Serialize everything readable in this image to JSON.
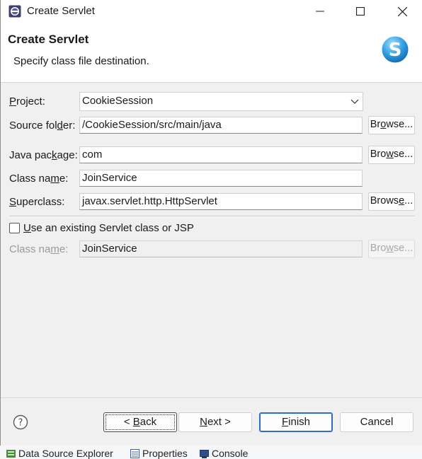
{
  "window": {
    "title": "Create Servlet",
    "app_icon": "eclipse-icon",
    "controls": [
      "minimize-icon",
      "maximize-icon",
      "close-icon"
    ]
  },
  "banner": {
    "title": "Create Servlet",
    "subtitle": "Specify class file destination.",
    "logo_letter": "S"
  },
  "form": {
    "project": {
      "label_pre": "",
      "label_u": "P",
      "label_post": "roject:",
      "value": "CookieSession"
    },
    "source_folder": {
      "label_pre": "Source fol",
      "label_u": "d",
      "label_post": "er:",
      "value": "/CookieSession/src/main/java",
      "browse": {
        "pre": "Br",
        "u": "o",
        "post": "wse..."
      }
    },
    "java_package": {
      "label_pre": "Java pac",
      "label_u": "k",
      "label_post": "age:",
      "value": "com",
      "browse": {
        "pre": "Bro",
        "u": "w",
        "post": "se..."
      }
    },
    "class_name": {
      "label_pre": "Class na",
      "label_u": "m",
      "label_post": "e:",
      "value": "JoinService"
    },
    "superclass": {
      "label_pre": "",
      "label_u": "S",
      "label_post": "uperclass:",
      "value": "javax.servlet.http.HttpServlet",
      "browse": {
        "pre": "Brows",
        "u": "e",
        "post": "..."
      }
    },
    "existing": {
      "label_pre": "",
      "label_u": "U",
      "label_post": "se an existing Servlet class or JSP",
      "checked": false
    },
    "existing_class_name": {
      "label_pre": "Class na",
      "label_u": "m",
      "label_post": "e:",
      "value": "JoinService",
      "browse": {
        "pre": "Bro",
        "u": "w",
        "post": "se..."
      }
    }
  },
  "footer": {
    "help_icon": "help-icon",
    "back": {
      "pre": "< ",
      "u": "B",
      "post": "ack"
    },
    "next": {
      "pre": "",
      "u": "N",
      "post": "ext >"
    },
    "finish": {
      "pre": "",
      "u": "F",
      "post": "inish"
    },
    "cancel": "Cancel"
  },
  "background_views": [
    {
      "label": "Data Source Explorer",
      "icon": "data-source-icon"
    },
    {
      "label": "Properties",
      "icon": "properties-icon"
    },
    {
      "label": "Console",
      "icon": "console-icon"
    }
  ]
}
